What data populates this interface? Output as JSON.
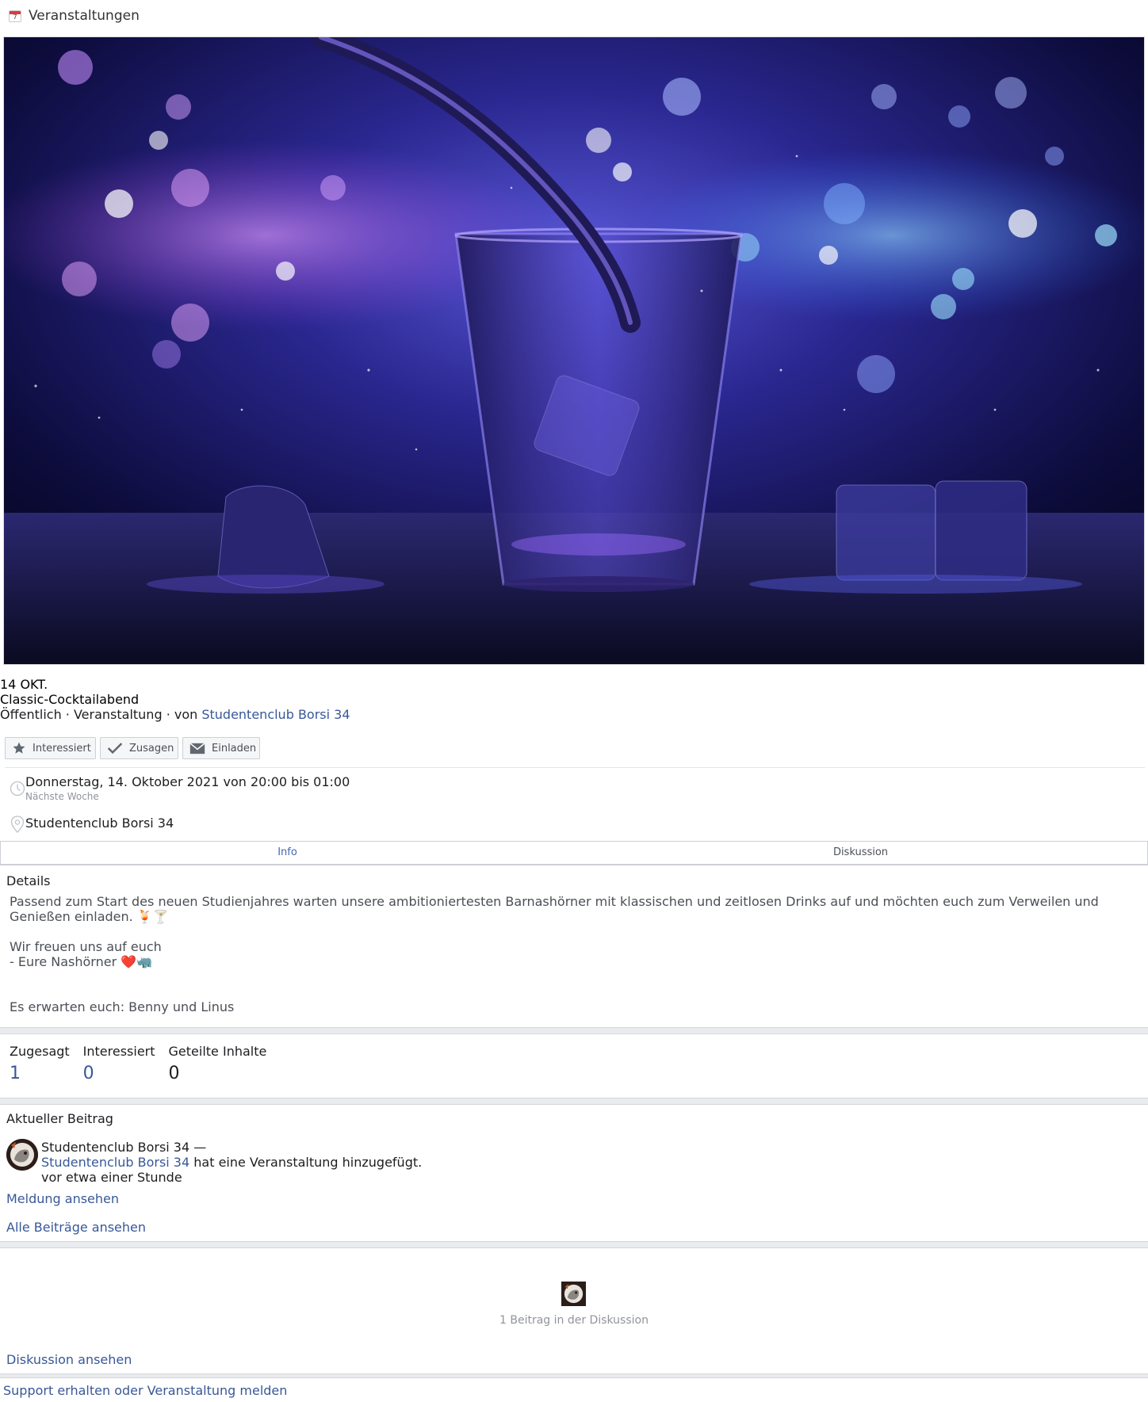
{
  "header": {
    "title": "Veranstaltungen",
    "calendar_icon_number": "7"
  },
  "event": {
    "date": "14 OKT.",
    "title": "Classic-Cocktailabend",
    "meta_prefix": "Öffentlich · Veranstaltung · von ",
    "host": "Studentenclub Borsi 34"
  },
  "actions": {
    "interested": "Interessiert",
    "going": "Zusagen",
    "invite": "Einladen"
  },
  "time": {
    "main": "Donnerstag, 14. Oktober 2021 von 20:00 bis 01:00",
    "sub": "Nächste Woche"
  },
  "location": {
    "name": "Studentenclub Borsi 34"
  },
  "tabs": {
    "info": "Info",
    "discussion": "Diskussion"
  },
  "details": {
    "heading": "Details",
    "line1": "Passend zum Start des neuen Studienjahres warten unsere ambitioniertesten Barnashörner mit klassischen und zeitlosen Drinks auf und möchten euch zum Verweilen und",
    "line2": "Genießen einladen. 🍹🍸",
    "line3": "Wir freuen uns auf euch",
    "line4": "- Eure Nashörner ❤️🦏",
    "line5": "Es erwarten euch: Benny und Linus"
  },
  "stats": {
    "going_label": "Zugesagt",
    "going_value": "1",
    "interested_label": "Interessiert",
    "interested_value": "0",
    "shared_label": "Geteilte Inhalte",
    "shared_value": "0"
  },
  "recent": {
    "heading": "Aktueller Beitrag",
    "author_line": "Studentenclub Borsi 34 —",
    "actor_link": "Studentenclub Borsi 34",
    "action_text": " hat eine Veranstaltung hinzugefügt.",
    "time": "vor etwa einer Stunde",
    "view_post": "Meldung ansehen",
    "all_posts": "Alle Beiträge ansehen"
  },
  "discussion": {
    "count_text": "1 Beitrag in der Diskussion",
    "view": "Diskussion ansehen"
  },
  "footer": {
    "support": "Support erhalten oder Veranstaltung melden"
  },
  "colors": {
    "link": "#385898",
    "tab_active": "#4267b2",
    "band": "#e9ebee"
  }
}
